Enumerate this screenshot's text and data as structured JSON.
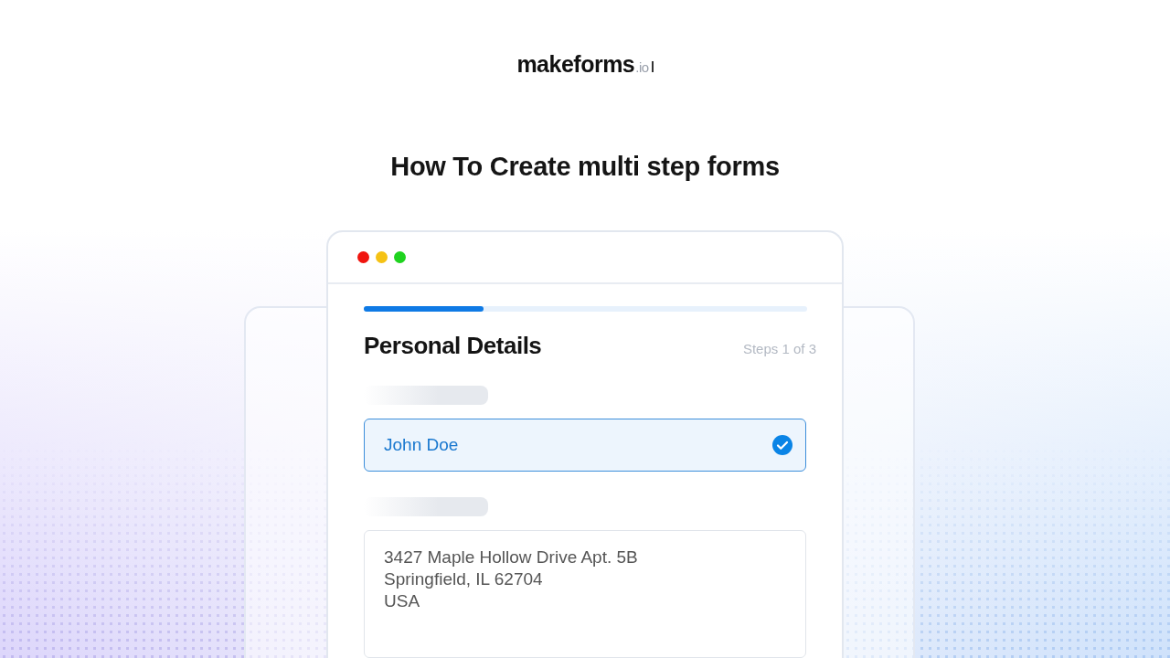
{
  "logo": {
    "name": "makeforms",
    "suffix": ".io"
  },
  "title": "How To Create multi step forms",
  "form": {
    "window_dots": [
      {
        "color": "#f0150f"
      },
      {
        "color": "#f5c214"
      },
      {
        "color": "#1fd31f"
      }
    ],
    "progress": {
      "level": 0.27
    },
    "heading": "Personal Details",
    "step_text": "Steps 1 of 3",
    "fields": [
      {
        "kind": "text",
        "value": "John Doe",
        "valid": true
      },
      {
        "kind": "textarea",
        "value": "3427 Maple Hollow Drive Apt. 5B\nSpringfield, IL 62704\nUSA"
      }
    ]
  }
}
